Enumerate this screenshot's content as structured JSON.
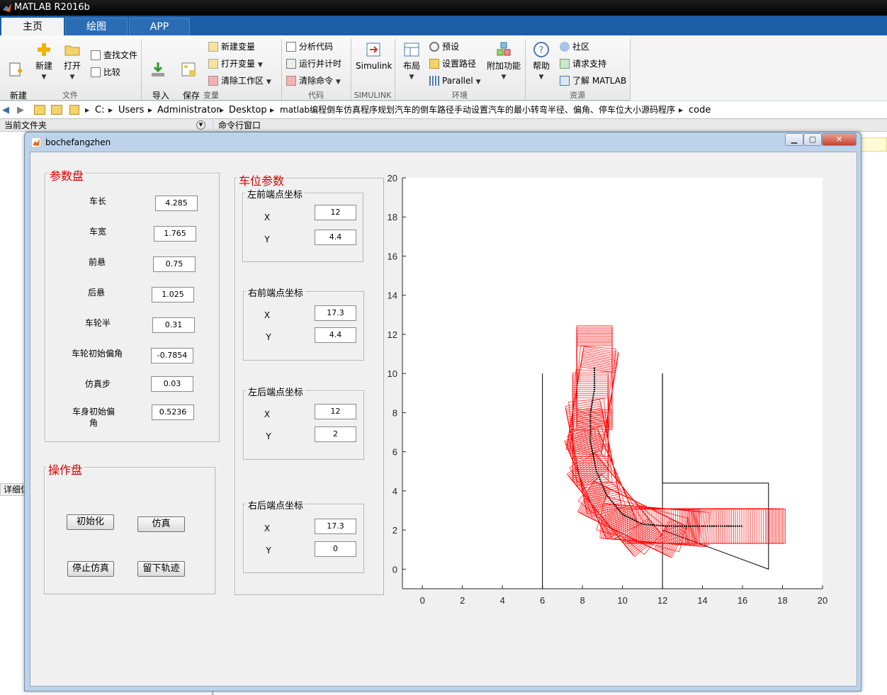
{
  "app": {
    "title": "MATLAB R2016b"
  },
  "tabs": [
    {
      "label": "主页",
      "active": true
    },
    {
      "label": "绘图",
      "active": false
    },
    {
      "label": "APP",
      "active": false
    }
  ],
  "ribbon": {
    "file": {
      "group": "文件",
      "new_script": "新建\n脚本",
      "new": "新建",
      "open": "打开",
      "find_files": "查找文件",
      "compare": "比较"
    },
    "variable": {
      "group": "变量",
      "import": "导入\n数据",
      "save_ws": "保存\n工作区",
      "new_var": "新建变量",
      "open_var": "打开变量",
      "clear_ws": "清除工作区"
    },
    "code": {
      "group": "代码",
      "analyze": "分析代码",
      "run_time": "运行并计时",
      "clear_cmd": "清除命令"
    },
    "simulink": {
      "group": "SIMULINK",
      "simulink": "Simulink"
    },
    "env": {
      "group": "环境",
      "layout": "布局",
      "prefs": "预设",
      "set_path": "设置路径",
      "parallel": "Parallel",
      "addons": "附加功能"
    },
    "resources": {
      "group": "资源",
      "help": "帮助",
      "community": "社区",
      "support": "请求支持",
      "learn": "了解 MATLAB"
    }
  },
  "address": {
    "segments": [
      "C:",
      "Users",
      "Administrator",
      "Desktop",
      "matlab编程倒车仿真程序规划汽车的倒车路径手动设置汽车的最小转弯半径、偏角、停车位大小源码程序",
      "code"
    ]
  },
  "panes": {
    "current_folder": "当前文件夹",
    "command_window": "命令行窗口",
    "details": "详细信息"
  },
  "figure": {
    "title": "bochefangzhen",
    "params_panel": {
      "title": "参数盘",
      "fields": [
        {
          "label": "车长",
          "value": "4.285"
        },
        {
          "label": "车宽",
          "value": "1.765"
        },
        {
          "label": "前悬",
          "value": "0.75"
        },
        {
          "label": "后悬",
          "value": "1.025"
        },
        {
          "label": "车轮半",
          "value": "0.31"
        },
        {
          "label": "车轮初始偏角",
          "value": "-0.7854"
        },
        {
          "label": "仿真步",
          "value": "0.03"
        },
        {
          "label": "车身初始偏\n角",
          "value": "0.5236"
        }
      ]
    },
    "ops_panel": {
      "title": "操作盘",
      "init": "初始化",
      "simulate": "仿真",
      "stop": "停止仿真",
      "keep_trace": "留下轨迹"
    },
    "slot_panel": {
      "title": "车位参数",
      "groups": [
        {
          "title": "左前端点坐标",
          "x": "12",
          "y": "4.4"
        },
        {
          "title": "右前端点坐标",
          "x": "17.3",
          "y": "4.4"
        },
        {
          "title": "左后端点坐标",
          "x": "12",
          "y": "2"
        },
        {
          "title": "右后端点坐标",
          "x": "17.3",
          "y": "0"
        }
      ],
      "x_label": "X",
      "y_label": "Y"
    }
  },
  "chart_data": {
    "type": "line",
    "title": "",
    "xlabel": "",
    "ylabel": "",
    "xlim": [
      -1,
      20
    ],
    "ylim": [
      -1,
      20
    ],
    "xticks": [
      0,
      2,
      4,
      6,
      8,
      10,
      12,
      14,
      16,
      18,
      20
    ],
    "yticks": [
      0,
      2,
      4,
      6,
      8,
      10,
      12,
      14,
      16,
      18,
      20
    ],
    "grid": false,
    "boundary_lines": [
      {
        "x": [
          6,
          6
        ],
        "y": [
          -1,
          10
        ]
      },
      {
        "x": [
          12,
          12
        ],
        "y": [
          -1,
          10
        ]
      },
      {
        "x": [
          12,
          12,
          17.3,
          17.3,
          12
        ],
        "y": [
          10,
          4.4,
          4.4,
          0,
          2
        ]
      }
    ],
    "car_trace": {
      "color": "#ff0000",
      "path_center_x": [
        8.6,
        8.6,
        8.4,
        8.4,
        8.7,
        9.2,
        10.0,
        11.0,
        12.2,
        13.5,
        15.0,
        16.0
      ],
      "path_center_y": [
        10.3,
        9.2,
        8.0,
        6.5,
        5.0,
        3.8,
        2.8,
        2.3,
        2.2,
        2.2,
        2.2,
        2.2
      ]
    },
    "track_color": "#000000"
  }
}
